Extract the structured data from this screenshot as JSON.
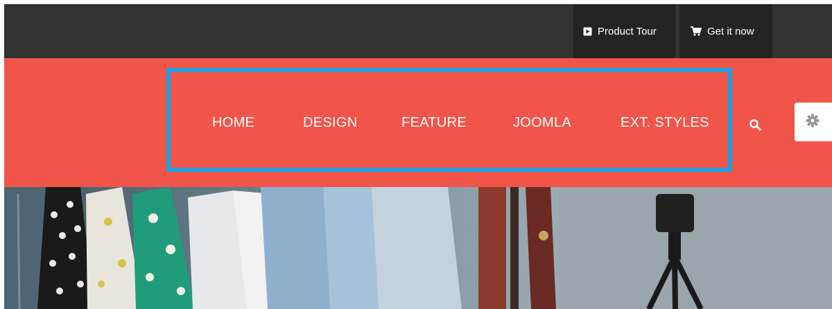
{
  "topbar": {
    "product_tour": {
      "label": "Product Tour",
      "icon": "play-square-icon"
    },
    "get_it_now": {
      "label": "Get it now",
      "icon": "shopping-cart-icon"
    }
  },
  "nav": {
    "items": [
      {
        "label": "HOME"
      },
      {
        "label": "DESIGN"
      },
      {
        "label": "FEATURE"
      },
      {
        "label": "JOOMLA"
      },
      {
        "label": "EXT. STYLES"
      }
    ],
    "search_icon": "search-icon",
    "settings_icon": "gear-icon"
  },
  "colors": {
    "topbar": "#323232",
    "topbar_button": "#242424",
    "nav": "#f15448",
    "highlight": "#1e9fe0",
    "text": "#ffffff"
  }
}
